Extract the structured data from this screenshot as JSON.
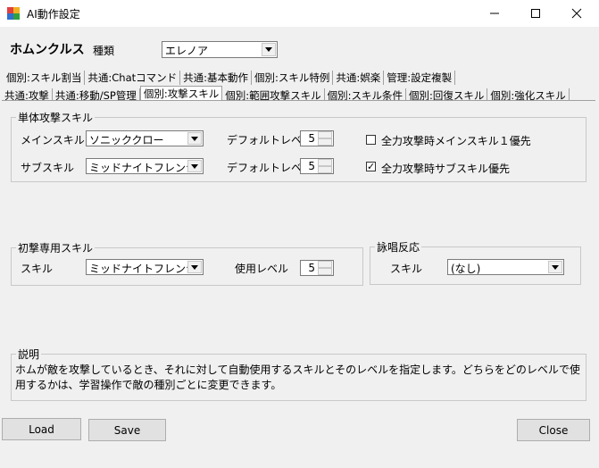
{
  "window": {
    "title": "AI動作設定",
    "controls": {
      "minimize": "—",
      "maximize": "☐",
      "close": "✕"
    }
  },
  "header": {
    "homunculus_label": "ホムンクルス",
    "kind_label": "種類",
    "kind_value": "エレノア"
  },
  "tabs": {
    "row1": [
      "個別:スキル割当",
      "共通:Chatコマンド",
      "共通:基本動作",
      "個別:スキル特例",
      "共通:娯楽",
      "管理:設定複製"
    ],
    "row2": [
      "共通:攻撃",
      "共通:移動/SP管理",
      "個別:攻撃スキル",
      "個別:範囲攻撃スキル",
      "個別:スキル条件",
      "個別:回復スキル",
      "個別:強化スキル"
    ],
    "active": "個別:攻撃スキル"
  },
  "single_attack": {
    "group_label": "単体攻撃スキル",
    "main_skill_label": "メインスキル",
    "main_skill_value": "ソニッククロー",
    "main_level_label": "デフォルトレベル",
    "main_level_value": "5",
    "main_priority_label": "全力攻撃時メインスキル１優先",
    "main_priority_checked": false,
    "sub_skill_label": "サブスキル",
    "sub_skill_value": "ミッドナイトフレンジ",
    "sub_level_label": "デフォルトレベル",
    "sub_level_value": "5",
    "sub_priority_label": "全力攻撃時サブスキル優先",
    "sub_priority_checked": true,
    "check_mark": "✓"
  },
  "first_attack": {
    "group_label": "初撃専用スキル",
    "skill_label": "スキル",
    "skill_value": "ミッドナイトフレンジ",
    "level_label": "使用レベル",
    "level_value": "5"
  },
  "chant": {
    "group_label": "詠唱反応",
    "skill_label": "スキル",
    "skill_value": "(なし)"
  },
  "description": {
    "group_label": "説明",
    "text": "ホムが敵を攻撃しているとき、それに対して自動使用するスキルとそのレベルを指定します。どちらをどのレベルで使用するかは、学習操作で敵の種別ごとに変更できます。"
  },
  "buttons": {
    "load": "Load",
    "save": "Save",
    "close": "Close"
  }
}
